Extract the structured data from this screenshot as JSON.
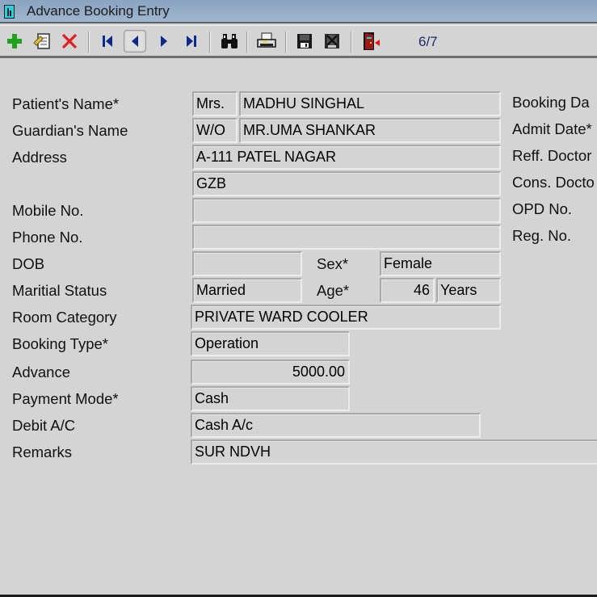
{
  "window": {
    "title": "Advance Booking Entry"
  },
  "toolbar": {
    "buttons": [
      {
        "name": "add",
        "icon": "plus-icon"
      },
      {
        "name": "edit",
        "icon": "edit-document-icon"
      },
      {
        "name": "delete",
        "icon": "delete-x-icon"
      },
      {
        "name": "first",
        "icon": "first-record-icon"
      },
      {
        "name": "previous",
        "icon": "previous-record-icon"
      },
      {
        "name": "next",
        "icon": "next-record-icon"
      },
      {
        "name": "last",
        "icon": "last-record-icon"
      },
      {
        "name": "find",
        "icon": "binoculars-icon"
      },
      {
        "name": "print",
        "icon": "printer-icon"
      },
      {
        "name": "save",
        "icon": "floppy-disk-icon"
      },
      {
        "name": "cancel",
        "icon": "cancel-disk-icon"
      },
      {
        "name": "exit",
        "icon": "exit-door-icon"
      }
    ],
    "record_counter": "6/7"
  },
  "form": {
    "labels": {
      "patient_name": "Patient's Name*",
      "guardian_name": "Guardian's Name",
      "address": "Address",
      "mobile": "Mobile No.",
      "phone": "Phone No.",
      "dob": "DOB",
      "sex": "Sex*",
      "marital_status": "Maritial Status",
      "age": "Age*",
      "room_category": "Room Category",
      "booking_type": "Booking Type*",
      "advance": "Advance",
      "payment_mode": "Payment Mode*",
      "debit_ac": "Debit A/C",
      "remarks": "Remarks"
    },
    "values": {
      "patient_title": "Mrs.",
      "patient_name": "MADHU SINGHAL",
      "guardian_relation": "W/O",
      "guardian_name": "MR.UMA SHANKAR",
      "address_line1": "A-111 PATEL NAGAR",
      "address_line2": "GZB",
      "mobile": "",
      "phone": "",
      "dob": "",
      "sex": "Female",
      "marital_status": "Married",
      "age": "46",
      "age_unit": "Years",
      "room_category": "PRIVATE WARD COOLER",
      "booking_type": "Operation",
      "advance": "5000.00",
      "payment_mode": "Cash",
      "debit_ac": "Cash A/c",
      "remarks": "SUR NDVH"
    },
    "right_labels": {
      "booking_date": "Booking Da",
      "admit_date": "Admit Date*",
      "reff_doctor": "Reff. Doctor",
      "cons_doctor": "Cons. Docto",
      "opd_no": "OPD No.",
      "reg_no": "Reg. No."
    }
  }
}
